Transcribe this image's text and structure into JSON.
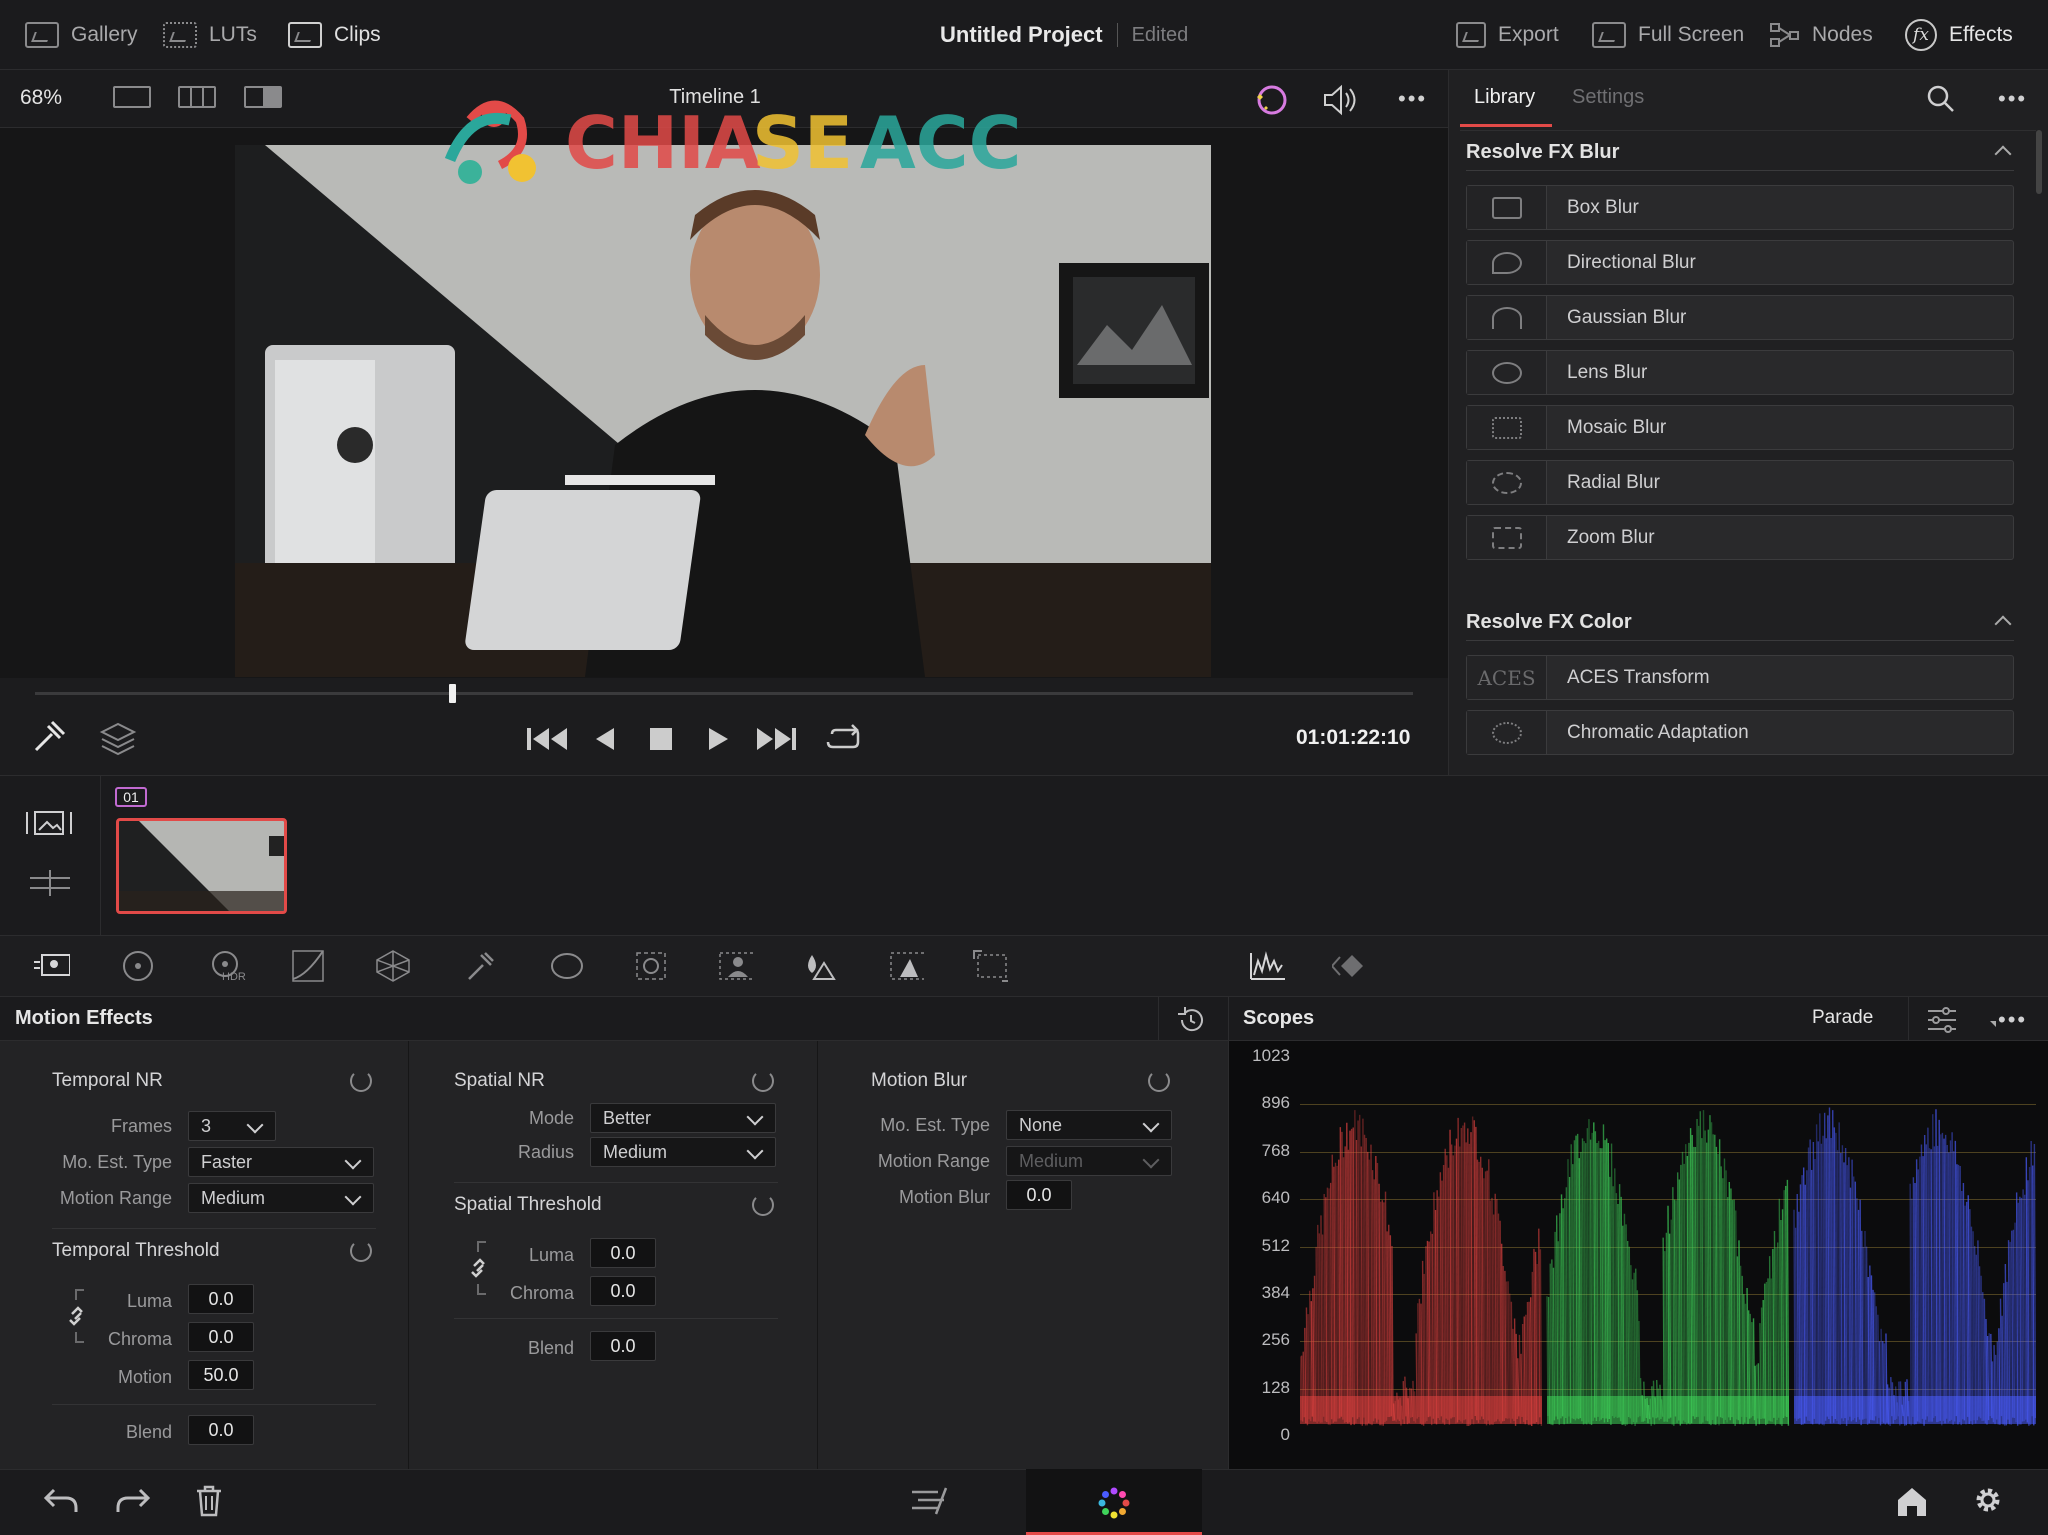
{
  "topbar": {
    "gallery": "Gallery",
    "luts": "LUTs",
    "clips": "Clips",
    "project_title": "Untitled Project",
    "project_status": "Edited",
    "export": "Export",
    "full_screen": "Full Screen",
    "nodes": "Nodes",
    "effects": "Effects"
  },
  "viewer": {
    "zoom": "68%",
    "timeline_title": "Timeline 1",
    "timecode": "01:01:22:10",
    "playhead_fraction": 0.3
  },
  "library": {
    "tab_library": "Library",
    "tab_settings": "Settings",
    "blur_section": "Resolve FX Blur",
    "blur_items": [
      "Box Blur",
      "Directional Blur",
      "Gaussian Blur",
      "Lens Blur",
      "Mosaic Blur",
      "Radial Blur",
      "Zoom Blur"
    ],
    "color_section": "Resolve FX Color",
    "color_items": [
      "ACES Transform",
      "Chromatic Adaptation"
    ],
    "aces_thumb": "ACES"
  },
  "clips": {
    "clip_number": "01"
  },
  "palette": {
    "hdr_label": "HDR"
  },
  "motion_effects": {
    "title": "Motion Effects",
    "temporal_nr": {
      "title": "Temporal NR",
      "frames_label": "Frames",
      "frames_value": "3",
      "mo_est_label": "Mo. Est. Type",
      "mo_est_value": "Faster",
      "motion_range_label": "Motion Range",
      "motion_range_value": "Medium"
    },
    "temporal_threshold": {
      "title": "Temporal Threshold",
      "luma_label": "Luma",
      "luma_value": "0.0",
      "chroma_label": "Chroma",
      "chroma_value": "0.0",
      "motion_label": "Motion",
      "motion_value": "50.0",
      "blend_label": "Blend",
      "blend_value": "0.0"
    },
    "spatial_nr": {
      "title": "Spatial NR",
      "mode_label": "Mode",
      "mode_value": "Better",
      "radius_label": "Radius",
      "radius_value": "Medium"
    },
    "spatial_threshold": {
      "title": "Spatial Threshold",
      "luma_label": "Luma",
      "luma_value": "0.0",
      "chroma_label": "Chroma",
      "chroma_value": "0.0",
      "blend_label": "Blend",
      "blend_value": "0.0"
    },
    "motion_blur": {
      "title": "Motion Blur",
      "mo_est_label": "Mo. Est. Type",
      "mo_est_value": "None",
      "motion_range_label": "Motion Range",
      "motion_range_value": "Medium",
      "motion_blur_label": "Motion Blur",
      "motion_blur_value": "0.0"
    }
  },
  "scopes": {
    "title": "Scopes",
    "mode": "Parade",
    "ticks": [
      "1023",
      "896",
      "768",
      "640",
      "512",
      "384",
      "256",
      "128",
      "0"
    ]
  },
  "colors": {
    "accent": "#e24a48",
    "red_trace": "#e0413f",
    "green_trace": "#3fd35a",
    "blue_trace": "#4a5cff"
  }
}
